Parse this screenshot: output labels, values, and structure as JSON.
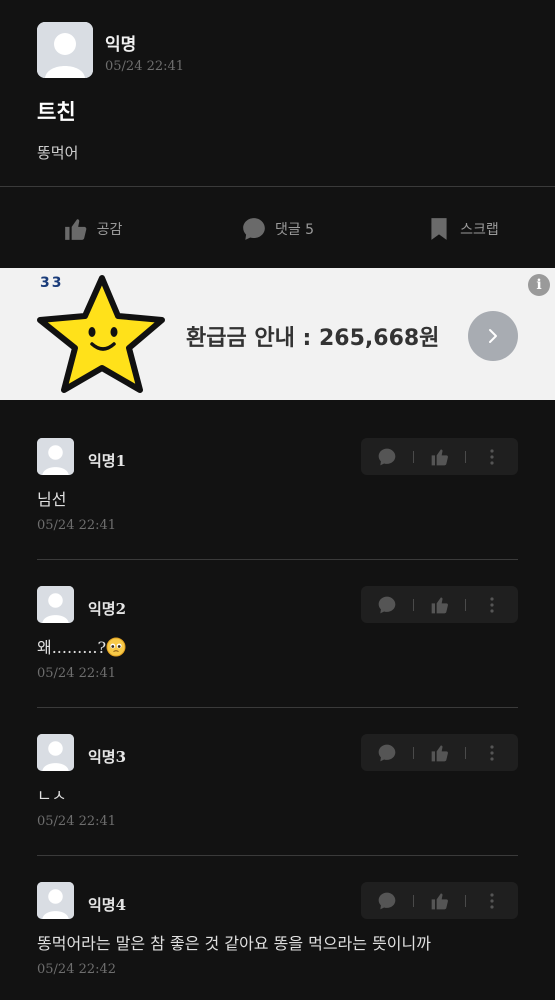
{
  "post": {
    "author": "익명",
    "time": "05/24 22:41",
    "title": "트친",
    "body": "똥먹어"
  },
  "actions": {
    "like_label": "공감",
    "comment_label": "댓글 5",
    "scrap_label": "스크랩"
  },
  "ad": {
    "logo_text": "33",
    "text": "환급금 안내 : 265,668원",
    "info_label": "i"
  },
  "comments": [
    {
      "author": "익명1",
      "text": "님선",
      "time": "05/24 22:41"
    },
    {
      "author": "익명2",
      "text": "왜.........?",
      "time": "05/24 22:41",
      "emoji": "pleading-face-icon"
    },
    {
      "author": "익명3",
      "text": "ㄴㅅ",
      "time": "05/24 22:41"
    },
    {
      "author": "익명4",
      "text": "똥먹어라는 말은 참 좋은 것 같아요 똥을 먹으라는 뜻이니까",
      "time": "05/24 22:42"
    }
  ],
  "colors": {
    "background": "#121212",
    "ad_background": "#f2f2f2",
    "icon_gray": "#6a6a6a",
    "star_yellow": "#ffe11a"
  }
}
